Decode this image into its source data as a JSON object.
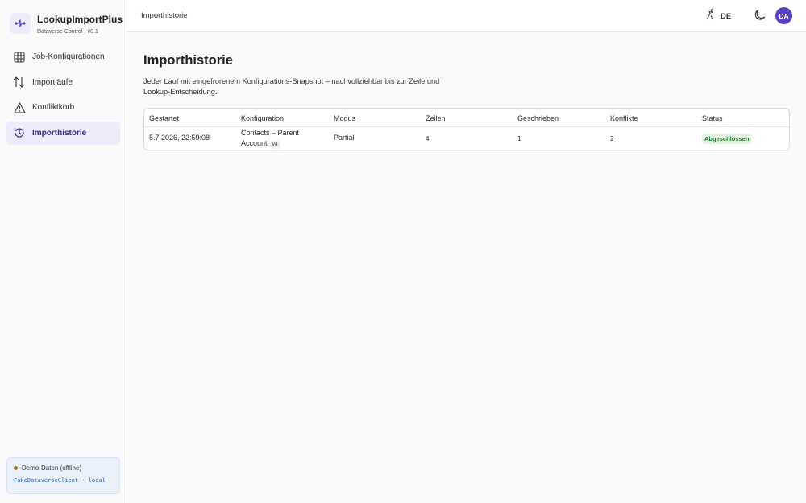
{
  "app": {
    "title": "LookupImportPlus",
    "subtitle": "Dataverse Control · v0.1"
  },
  "sidebar": {
    "items": [
      {
        "label": "Job-Konfigurationen",
        "icon": "grid-icon",
        "active": false
      },
      {
        "label": "Importläufe",
        "icon": "arrows-updown-icon",
        "active": false
      },
      {
        "label": "Konfliktkorb",
        "icon": "warning-icon",
        "active": false
      },
      {
        "label": "Importhistorie",
        "icon": "history-icon",
        "active": true
      }
    ],
    "demo": {
      "status": "Demo-Daten (offline)",
      "client": "FakeDataverseClient · local",
      "dot_color": "#a8741a"
    }
  },
  "header": {
    "breadcrumb": "Importhistorie",
    "language": "DE",
    "avatar_initials": "DA",
    "avatar_color": "#5b3fc4"
  },
  "page": {
    "title": "Importhistorie",
    "description": "Jeder Lauf mit eingefrorenem Konfigurations-Snapshot – nachvollziehbar bis zur Zeile und Lookup-Entscheidung."
  },
  "table": {
    "columns": [
      "Gestartet",
      "Konfiguration",
      "Modus",
      "Zeilen",
      "Geschrieben",
      "Konflikte",
      "Status"
    ],
    "rows": [
      {
        "started": "5.7.2026, 22:59:08",
        "config": "Contacts – Parent Account",
        "version": "v4",
        "mode": "Partial",
        "rows": "4",
        "written": "1",
        "conflicts": "2",
        "status": "Abgeschlossen"
      }
    ]
  },
  "colors": {
    "accent": "#5b3fc4",
    "active_nav_bg": "#eeebfa",
    "status_success_bg": "#e6f4e6",
    "status_success_fg": "#207a2a"
  }
}
